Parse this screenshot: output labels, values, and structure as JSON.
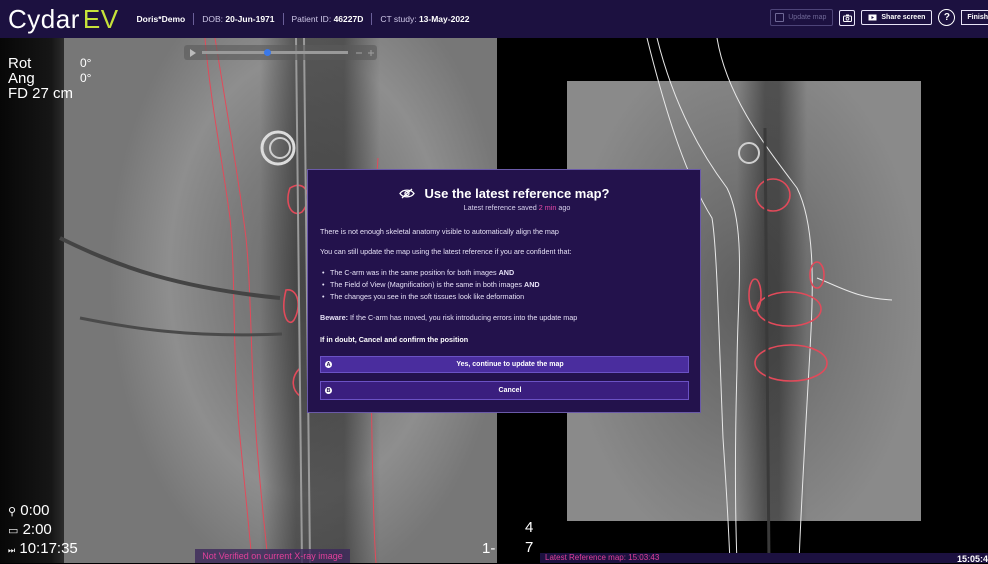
{
  "app": {
    "name_main": "Cydar",
    "name_accent": "EV"
  },
  "patient": {
    "name": "Doris*Demo",
    "dob_label": "DOB:",
    "dob": "20-Jun-1971",
    "id_label": "Patient ID:",
    "id": "46227D",
    "ct_label": "CT study:",
    "ct_date": "13-May-2022"
  },
  "toolbar": {
    "update_map": "Update map",
    "share_screen": "Share screen",
    "help": "?",
    "finish": "Finish"
  },
  "left_view": {
    "rot": "Rot",
    "ang": "Ang",
    "rot_val": "0°",
    "ang_val": "0°",
    "fd": "FD 27 cm",
    "time1": "0:00",
    "time2": "2:00",
    "time3": "10:17:35",
    "not_verified": "Not Verified on current X-ray image",
    "num_left": "1-",
    "num_right_top": "4",
    "num_right_bottom": "7"
  },
  "right_view": {
    "latest_ref": "Latest Reference map: 15:03:43",
    "clock": "15:05:4"
  },
  "dialog": {
    "title": "Use the latest reference map?",
    "subtitle_pre": "Latest reference saved ",
    "subtitle_hl": "2 min",
    "subtitle_post": " ago",
    "p1": "There is not enough skeletal anatomy visible to automatically align the map",
    "p2": "You can still update the map using the latest reference if you are confident that:",
    "b1_pre": "The C-arm was in the same position for both images ",
    "b1_bold": "AND",
    "b2_pre": "The Field of View (Magnification) is the same in both images ",
    "b2_bold": "AND",
    "b3": "The changes you see in the soft tissues look like deformation",
    "beware_bold": "Beware:",
    "beware_rest": " If the C-arm has moved, you risk introducing errors into the update map",
    "if_doubt": "If in doubt, Cancel and confirm the position",
    "yes_key": "A",
    "yes_label": "Yes, continue to update the map",
    "cancel_key": "B",
    "cancel_label": "Cancel"
  },
  "colors": {
    "accent": "#c6e23a",
    "highlight": "#e64aa8",
    "header": "#1c1140",
    "dialog": "#23124c"
  }
}
